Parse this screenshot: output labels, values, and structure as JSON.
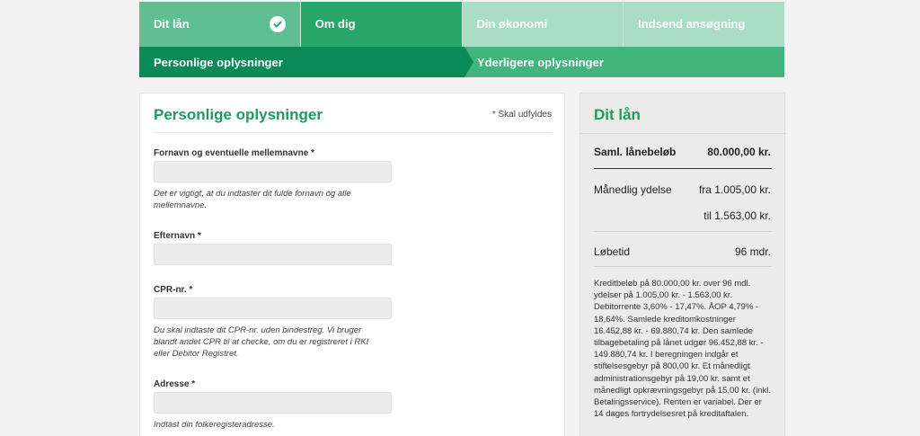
{
  "steps": [
    {
      "label": "Dit lån",
      "state": "done"
    },
    {
      "label": "Om dig",
      "state": "active"
    },
    {
      "label": "Din økonomi",
      "state": "pending"
    },
    {
      "label": "Indsend ansøgning",
      "state": "pending"
    }
  ],
  "substeps": [
    {
      "label": "Personlige oplysninger",
      "state": "active"
    },
    {
      "label": "Yderligere oplysninger",
      "state": "pending"
    }
  ],
  "form": {
    "title": "Personlige oplysninger",
    "required_note": "* Skal udfyldes",
    "fields": [
      {
        "label": "Fornavn og eventuelle mellemnavne *",
        "value": "",
        "help": "Det er vigtigt, at du indtaster dit fulde fornavn og alle mellemnavne."
      },
      {
        "label": "Efternavn *",
        "value": "",
        "help": ""
      },
      {
        "label": "CPR-nr. *",
        "value": "",
        "help": "Du skal indtaste dit CPR-nr. uden bindestreg. Vi bruger blandt andet CPR til at checke, om du er registreret i RKI eller Debitor Registret."
      },
      {
        "label": "Adresse *",
        "value": "",
        "help": "Indtast din folkeregisteradresse."
      }
    ]
  },
  "loan": {
    "title": "Dit lån",
    "total_label": "Saml. lånebeløb",
    "total_value": "80.000,00 kr.",
    "monthly_label": "Månedlig ydelse",
    "monthly_from": "fra 1.005,00 kr.",
    "monthly_to": "til 1.563,00 kr.",
    "term_label": "Løbetid",
    "term_value": "96 mdr.",
    "description": "Kreditbeløb på 80.000,00 kr. over 96 mdl. ydelser på 1.005,00 kr. - 1.563,00 kr. Debitorrente 3,60% - 17,47%. ÅOP 4,79% - 18,64%. Samlede kreditomkostninger 16.452,88 kr. - 69.880,74 kr. Den samlede tilbagebetaling på lånet udgør 96.452,88 kr. - 149.880,74 kr. I beregningen indgår et stiftelsesgebyr på 800,00 kr. Et månedligt administrationsgebyr på 19,00 kr. samt et månedligt opkrævningsgebyr på 15,00 kr. (inkl. Betalingsservice). Renten er variabel. Der er 14 dages fortrydelsesret på kreditaftalen."
  },
  "colors": {
    "accent": "#1f9a5f",
    "step_done": "#5fbf92",
    "step_active": "#28a76c",
    "step_pending": "#a8dcc3",
    "substep_active": "#0a8a55",
    "substep_pending": "#42b47e"
  }
}
